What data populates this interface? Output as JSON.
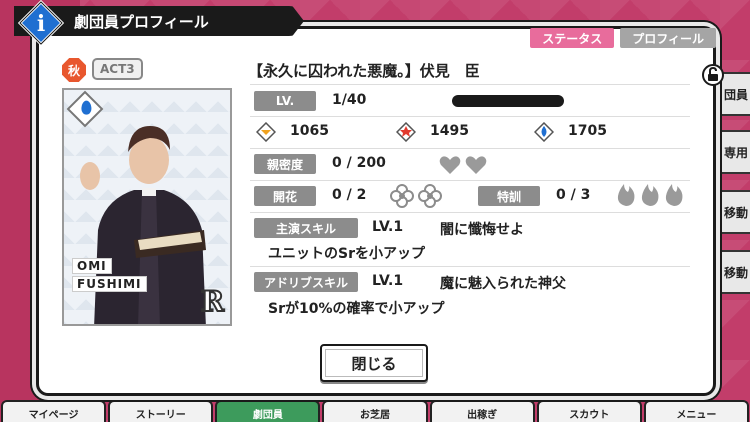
{
  "dialog": {
    "title": "劇団員プロフィール",
    "tabs": [
      "ステータス",
      "プロフィール"
    ],
    "close_label": "閉じる"
  },
  "card": {
    "season_badge": "秋",
    "act_badge": "ACT3",
    "name_line1": "OMI",
    "name_line2": "FUSHIMI",
    "rarity": "R"
  },
  "character": {
    "title": "【永久に囚われた悪魔。】伏見　臣",
    "level_label": "LV.",
    "level_value": "1/40",
    "stats": [
      "1065",
      "1495",
      "1705"
    ],
    "affection_label": "親密度",
    "affection_value": "0 / 200",
    "bloom_label": "開花",
    "bloom_value": "0 / 2",
    "training_label": "特訓",
    "training_value": "0 / 3",
    "lead_skill_label": "主演スキル",
    "lead_skill_level": "LV.1",
    "lead_skill_name": "闇に懺悔せよ",
    "lead_skill_desc": "ユニットのSrを小アップ",
    "adlib_skill_label": "アドリブスキル",
    "adlib_skill_level": "LV.1",
    "adlib_skill_name": "魔に魅入られた神父",
    "adlib_skill_desc": "Srが10%の確率で小アップ"
  },
  "side_buttons": [
    "団員",
    "専用",
    "移動",
    "移動"
  ],
  "bottom_nav": [
    "マイページ",
    "ストーリー",
    "劇団員",
    "お芝居",
    "出稼ぎ",
    "スカウト",
    "メニュー"
  ],
  "colors": {
    "background": "#c23d6a",
    "pink_tab": "#e86c9c",
    "gray_chip": "#8c8c8c",
    "stat_gold": "#f0a21f",
    "stat_red": "#e23a2e",
    "stat_blue": "#1f6fd1"
  }
}
